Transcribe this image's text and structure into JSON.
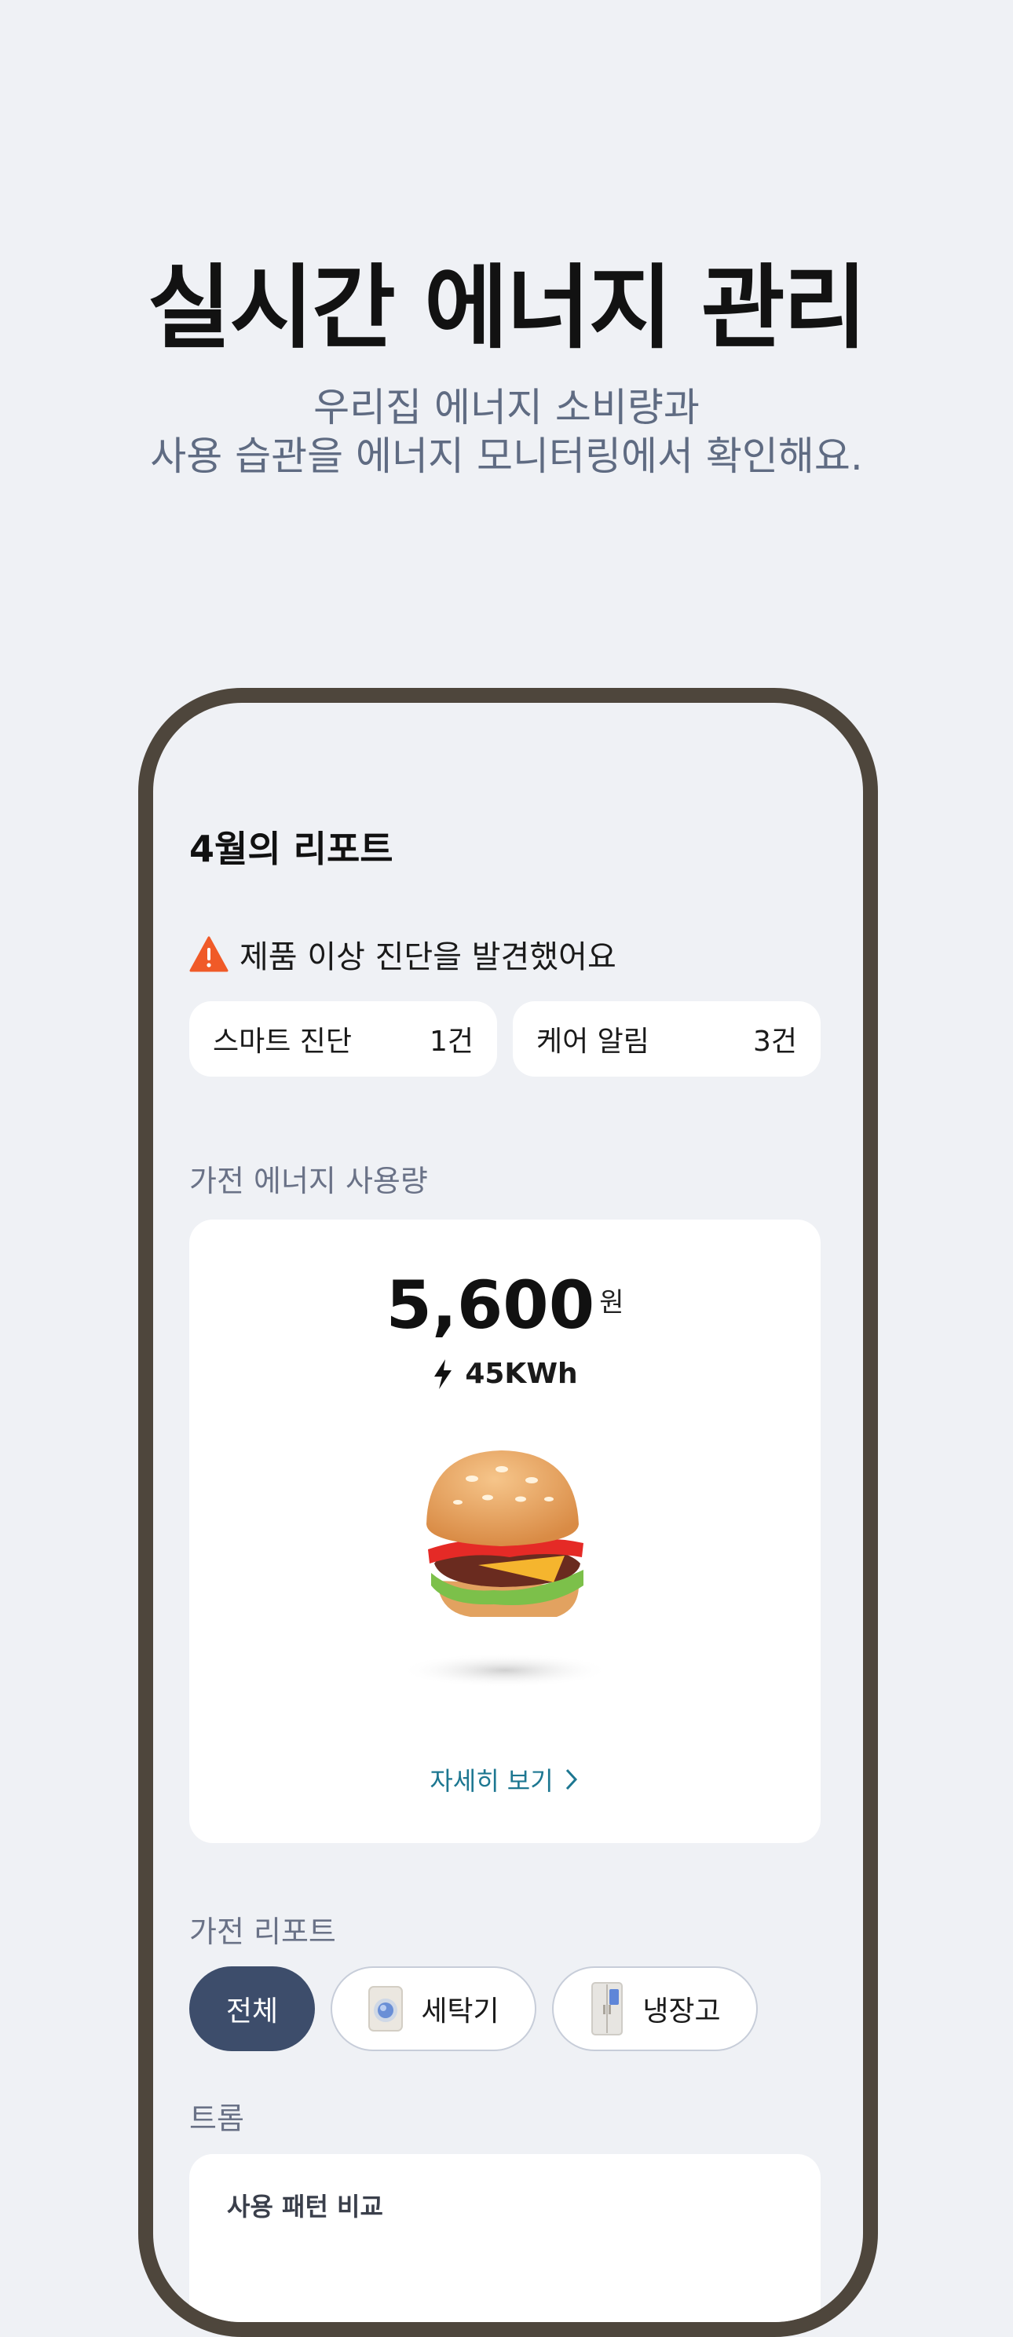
{
  "hero": {
    "title": "실시간 에너지 관리",
    "subtitle_line1": "우리집 에너지 소비량과",
    "subtitle_line2": "사용 습관을 에너지 모니터링에서 확인해요."
  },
  "report": {
    "title": "4월의 리포트",
    "alert_text": "제품 이상 진단을 발견했어요",
    "alert_icon": "warning-triangle-icon",
    "cards": [
      {
        "label": "스마트 진단",
        "count": "1건"
      },
      {
        "label": "케어 알림",
        "count": "3건"
      }
    ]
  },
  "energy": {
    "section_label": "가전 에너지 사용량",
    "amount": "5,600",
    "currency": "원",
    "kwh": "45KWh",
    "illustration": "burger-illustration",
    "detail_link": "자세히 보기"
  },
  "appliance_report": {
    "section_label": "가전 리포트",
    "chips": [
      {
        "label": "전체",
        "active": true
      },
      {
        "label": "세탁기",
        "icon": "washing-machine-icon",
        "active": false
      },
      {
        "label": "냉장고",
        "icon": "refrigerator-icon",
        "active": false
      }
    ]
  },
  "trom": {
    "section_label": "트롬",
    "card_title": "사용 패턴 비교"
  },
  "colors": {
    "background": "#eff1f5",
    "phone_frame": "#4e463c",
    "active_chip": "#3d4d6b",
    "link": "#1d7791",
    "alert": "#f05a28"
  }
}
